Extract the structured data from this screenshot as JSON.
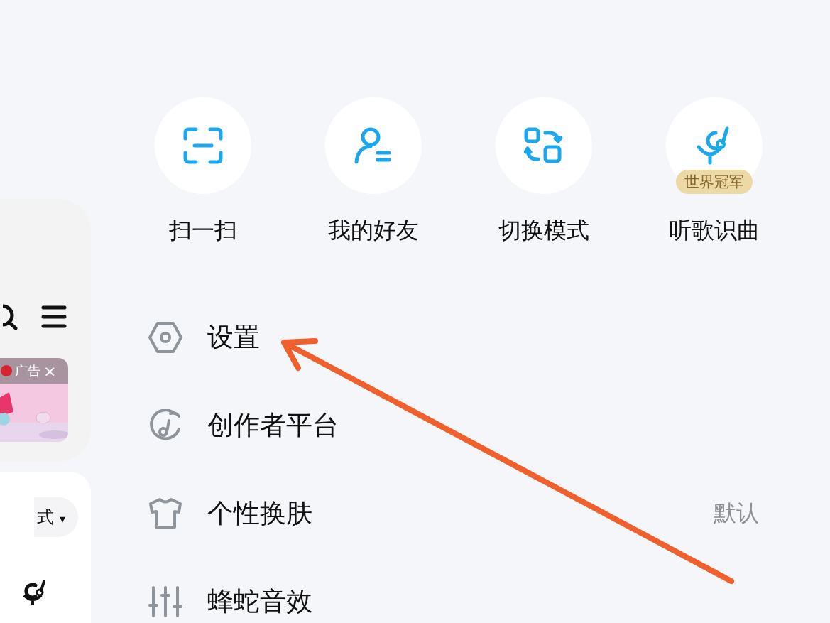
{
  "background_page": {
    "ad": {
      "label": "广告",
      "close": "×"
    },
    "mode_selector": {
      "label": "式",
      "caret": "▾"
    }
  },
  "quick_actions": [
    {
      "kind": "scan",
      "label": "扫一扫"
    },
    {
      "kind": "friends",
      "label": "我的好友"
    },
    {
      "kind": "switch",
      "label": "切换模式"
    },
    {
      "kind": "recognize",
      "label": "听歌识曲",
      "badge": "世界冠军"
    }
  ],
  "menu": [
    {
      "kind": "settings",
      "label": "设置"
    },
    {
      "kind": "creator",
      "label": "创作者平台"
    },
    {
      "kind": "skin",
      "label": "个性换肤",
      "value": "默认"
    },
    {
      "kind": "equalizer",
      "label": "蜂蛇音效"
    }
  ]
}
